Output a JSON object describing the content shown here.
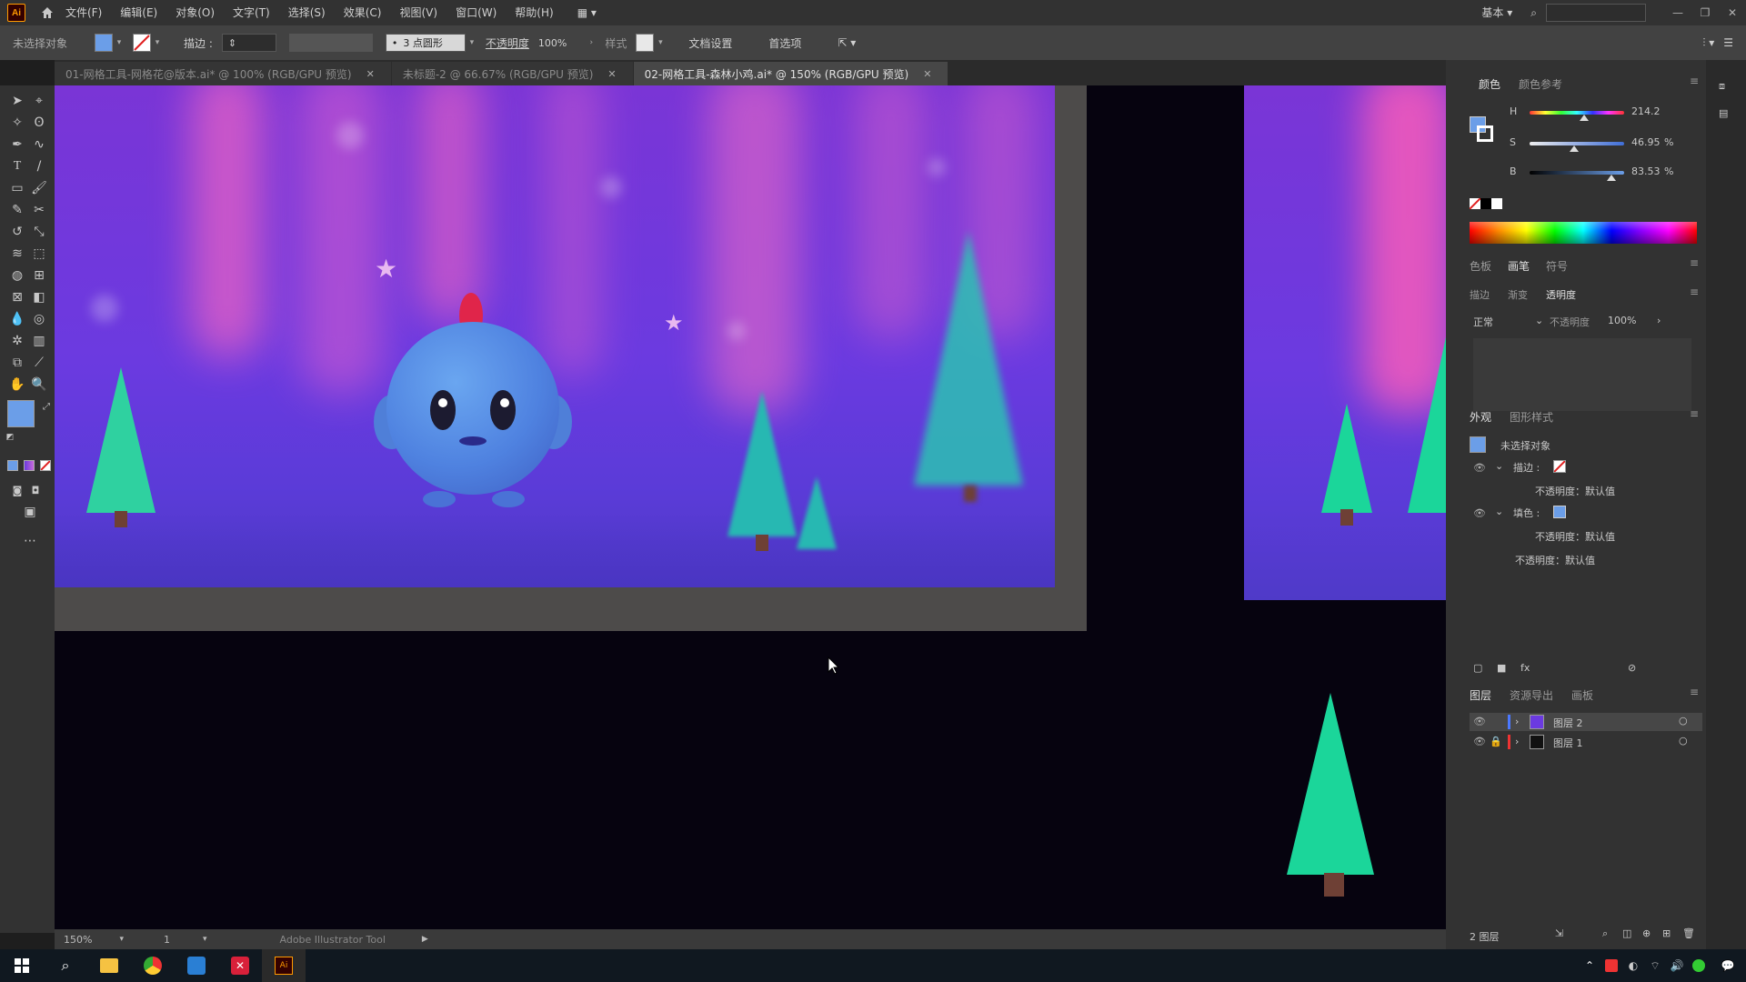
{
  "menu": {
    "app_logo": "Ai",
    "items": [
      "文件(F)",
      "编辑(E)",
      "对象(O)",
      "文字(T)",
      "选择(S)",
      "效果(C)",
      "视图(V)",
      "窗口(W)",
      "帮助(H)"
    ],
    "workspace": "基本"
  },
  "control": {
    "selection_label": "未选择对象",
    "stroke_label": "描边 :",
    "brush_label": "3 点圆形",
    "opacity_label": "不透明度",
    "opacity_value": "100%",
    "style_label": "样式",
    "doc_setup": "文档设置",
    "preferences": "首选项"
  },
  "tabs": [
    {
      "label": "01-网格工具-网格花@版本.ai* @ 100% (RGB/GPU 预览)",
      "active": false
    },
    {
      "label": "未标题-2 @ 66.67% (RGB/GPU 预览)",
      "active": false
    },
    {
      "label": "02-网格工具-森林小鸡.ai* @ 150% (RGB/GPU 预览)",
      "active": true
    }
  ],
  "status": {
    "zoom": "150%",
    "page": "1",
    "tool": "Adobe Illustrator Tool"
  },
  "color_panel": {
    "tabs": [
      "颜色",
      "颜色参考"
    ],
    "channels": [
      {
        "label": "H",
        "value": "214.2",
        "unit": "°",
        "fraction": 0.59
      },
      {
        "label": "S",
        "value": "46.95",
        "unit": "%",
        "fraction": 0.47
      },
      {
        "label": "B",
        "value": "83.53",
        "unit": "%",
        "fraction": 0.84
      }
    ]
  },
  "transparency_panel": {
    "tabs": [
      "色板",
      "画笔",
      "符号"
    ],
    "subtabs": [
      "描边",
      "渐变",
      "透明度"
    ],
    "blend_mode": "正常",
    "opacity_label": "不透明度",
    "opacity_value": "100%"
  },
  "appearance_panel": {
    "tabs": [
      "外观",
      "图形样式"
    ],
    "object": "未选择对象",
    "stroke_label": "描边 :",
    "stroke_opacity": "不透明度：默认值",
    "fill_label": "填色 :",
    "fill_opacity": "不透明度：默认值",
    "opacity": "不透明度：默认值"
  },
  "layers_panel": {
    "tabs": [
      "图层",
      "资源导出",
      "画板"
    ],
    "layers": [
      "图层 2",
      "图层 1"
    ],
    "footer": "2 图层"
  },
  "colors": {
    "accent_fill": "#6b9ee8",
    "tree_green": "#1bd69a",
    "aurora_pink": "#e266c8",
    "bg_purple": "#6b3ae0"
  }
}
